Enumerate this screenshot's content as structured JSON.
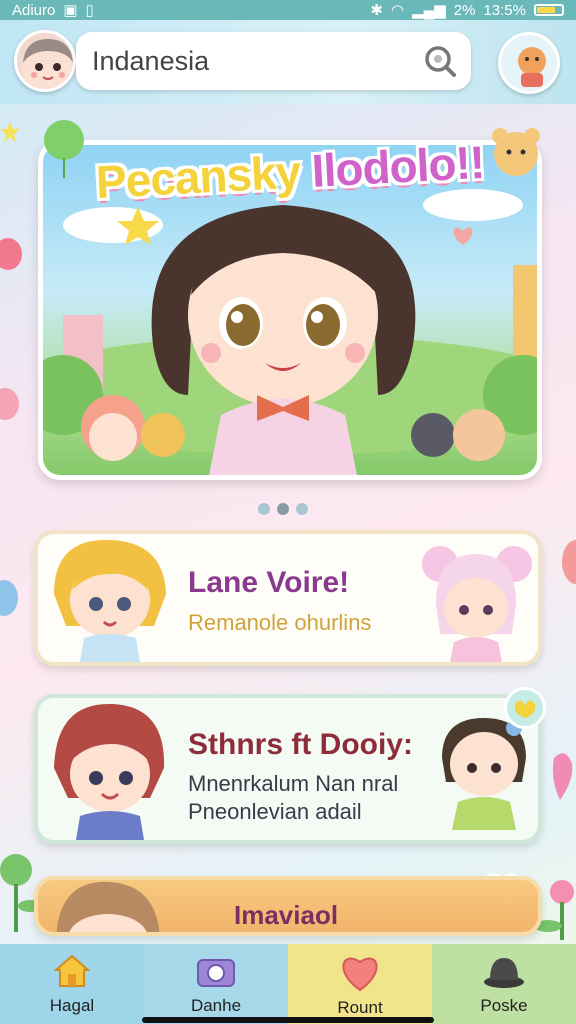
{
  "status_bar": {
    "carrier": "Adiuro",
    "battery_text": "13:5%",
    "signal_text": "2%"
  },
  "search": {
    "value": "Indanesia"
  },
  "banner": {
    "title_part1": "Pecansky",
    "title_part2": "Ilodolo!!",
    "slide_count": 3,
    "active_slide": 2
  },
  "cards": [
    {
      "title": "Lane Voire!",
      "subtitle": "Remanole ohurlins"
    },
    {
      "title": "Sthnrs ft Dooiy:",
      "subtitle_line1": "Mnenrkalum Nan nral",
      "subtitle_line2": "Pneonlevian adail"
    },
    {
      "title": "Imaviaol"
    }
  ],
  "nav": [
    {
      "label": "Hagal",
      "icon": "home-icon"
    },
    {
      "label": "Danhe",
      "icon": "camera-icon"
    },
    {
      "label": "Rount",
      "icon": "heart-icon"
    },
    {
      "label": "Poske",
      "icon": "hat-icon"
    }
  ],
  "colors": {
    "accent_purple": "#8a3a8e",
    "title_yellow": "#f4d23b",
    "title_pink": "#cf63c9"
  }
}
